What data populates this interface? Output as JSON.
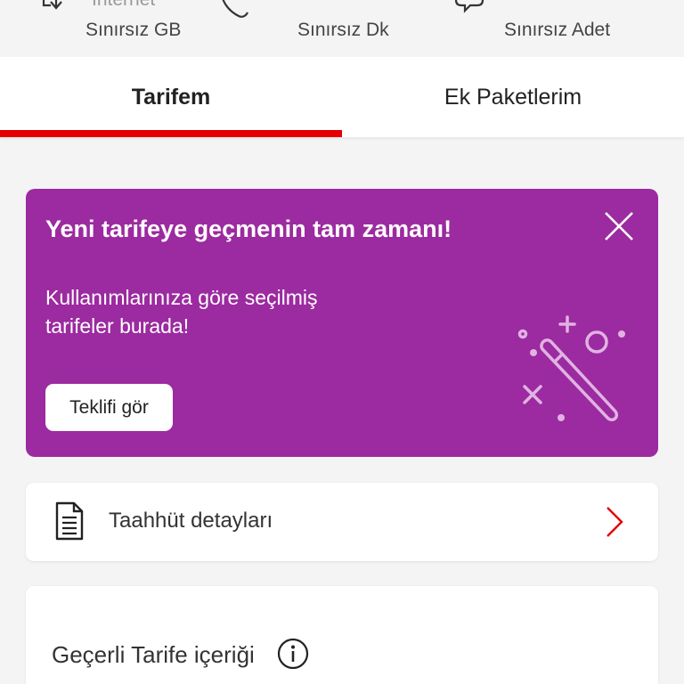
{
  "usage": {
    "internet": {
      "title": "İnternet",
      "value": "Sınırsız GB",
      "icon": "download-phone-icon"
    },
    "minutes": {
      "value": "Sınırsız Dk",
      "icon": "phone-icon"
    },
    "sms": {
      "value": "Sınırsız Adet",
      "icon": "chat-bubbles-icon"
    }
  },
  "tabs": [
    {
      "label": "Tarifem",
      "active": true
    },
    {
      "label": "Ek Paketlerim",
      "active": false
    }
  ],
  "promo": {
    "title": "Yeni tarifeye geçmenin tam zamanı!",
    "text": "Kullanımlarınıza göre seçilmiş tarifeler burada!",
    "button_label": "Teklifi gör",
    "close_icon": "close-icon",
    "illustration": "magic-wand-icon"
  },
  "commitment": {
    "label": "Taahhüt detayları",
    "icon": "document-icon",
    "chevron": "chevron-right-icon"
  },
  "tariff_content": {
    "title": "Geçerli Tarife içeriği",
    "icon": "info-icon"
  },
  "colors": {
    "accent_red": "#e60000",
    "promo_purple": "#9c2aa0",
    "background": "#f4f4f4"
  }
}
